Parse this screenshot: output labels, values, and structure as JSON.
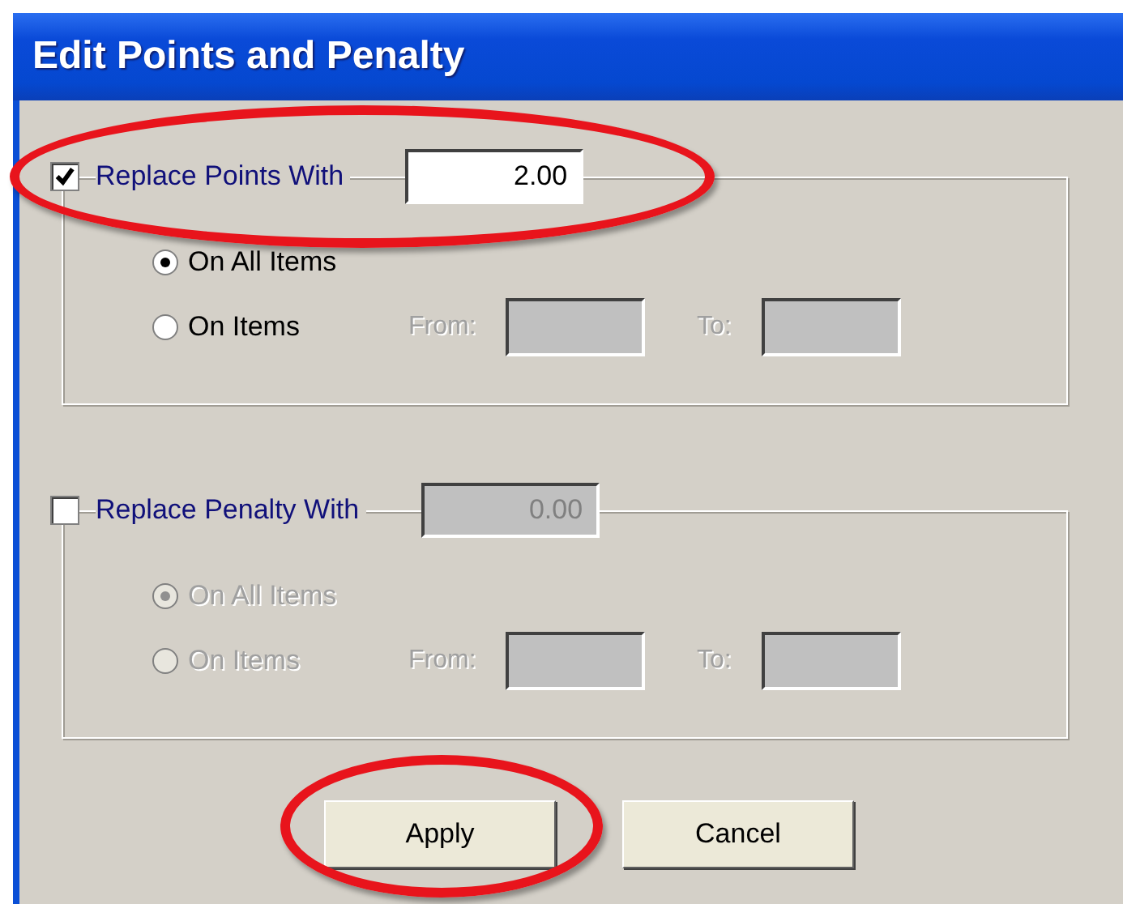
{
  "window": {
    "title": "Edit Points and Penalty"
  },
  "sections": [
    {
      "label": "Replace Points With",
      "checked": true,
      "highlighted": true,
      "value": "2.00",
      "options": [
        {
          "label": "On All Items",
          "selected": true
        },
        {
          "label": "On Items",
          "selected": false,
          "from_label": "From:",
          "to_label": "To:"
        }
      ]
    },
    {
      "label": "Replace Penalty With",
      "checked": false,
      "highlighted": false,
      "value": "0.00",
      "options": [
        {
          "label": "On All Items",
          "selected": true
        },
        {
          "label": "On Items",
          "selected": false,
          "from_label": "From:",
          "to_label": "To:"
        }
      ]
    }
  ],
  "buttons": [
    {
      "label": "Apply",
      "highlighted": true
    },
    {
      "label": "Cancel",
      "highlighted": false
    }
  ]
}
